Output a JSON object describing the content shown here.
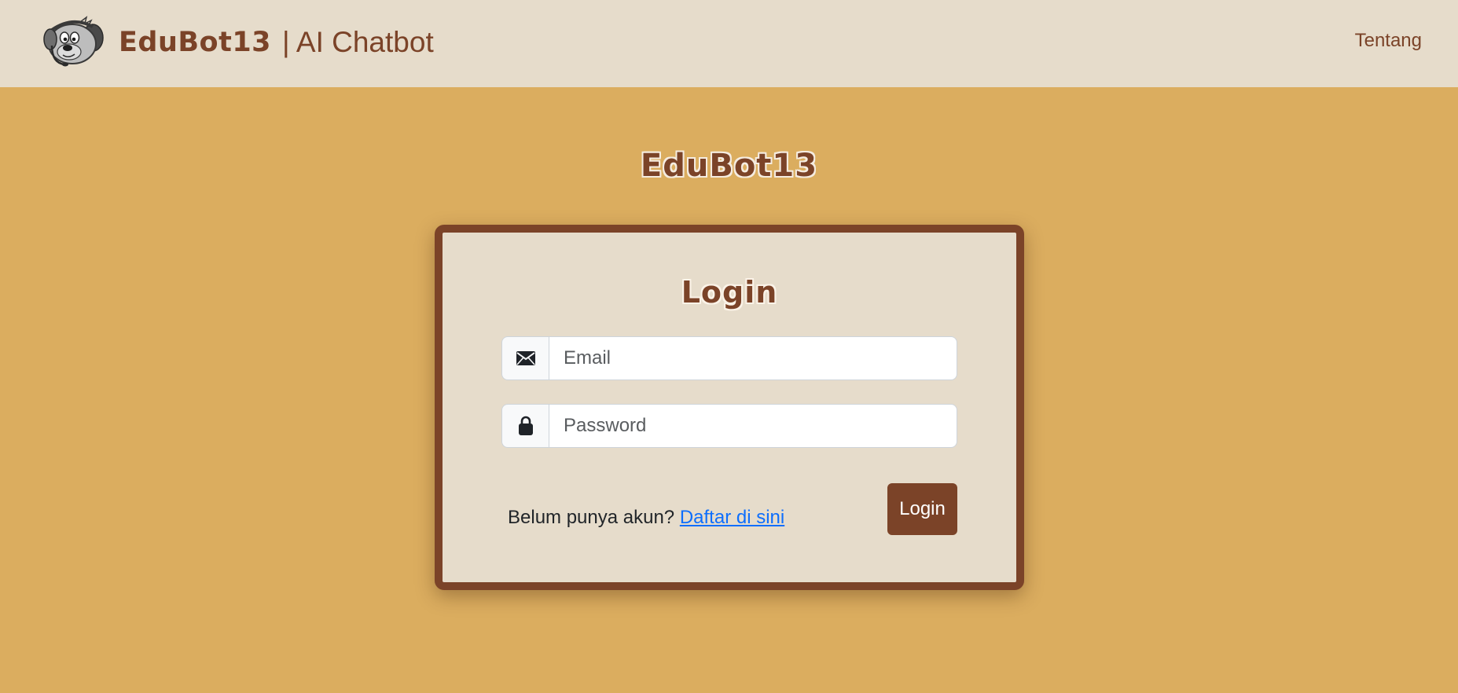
{
  "navbar": {
    "brand_name": "EduBot13",
    "brand_suffix": "| AI Chatbot",
    "about_link": "Tentang"
  },
  "hero": {
    "title": "EduBot13"
  },
  "login_card": {
    "title": "Login",
    "email_placeholder": "Email",
    "password_placeholder": "Password",
    "register_prompt": "Belum punya akun?",
    "register_link": "Daftar di sini",
    "submit_label": "Login"
  },
  "icons": {
    "email": "envelope-icon",
    "password": "lock-icon",
    "logo": "dog-headset-mascot-icon"
  },
  "colors": {
    "page_background": "#dbad5f",
    "navbar_background": "#e6dccb",
    "brand_brown": "#7b4328",
    "card_background": "#e6dccb",
    "link_blue": "#0d6efd"
  }
}
